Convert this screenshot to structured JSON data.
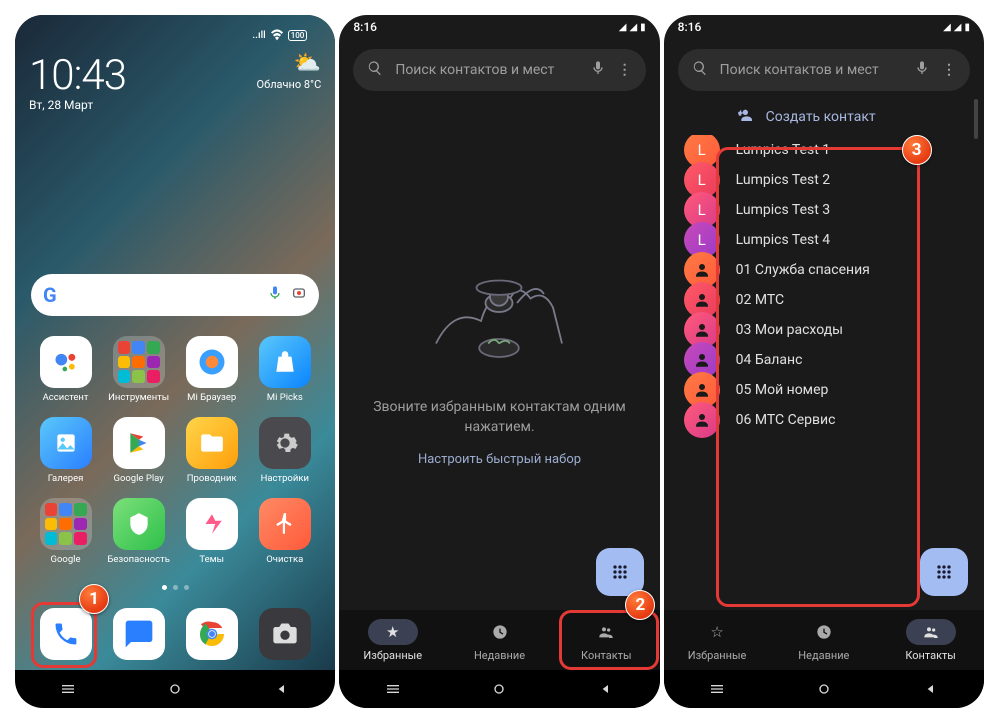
{
  "screen1": {
    "time": "10:43",
    "date": "Вт, 28 Март",
    "weather_text": "Облачно 8°C",
    "signal": "..ıll",
    "wifi": "📶",
    "battery": "100",
    "apps_row1": [
      {
        "label": "Ассистент",
        "bg": "#fff"
      },
      {
        "label": "Инструменты",
        "folder": true
      },
      {
        "label": "Mi Браузер",
        "bg": "#fff"
      },
      {
        "label": "Mi Picks",
        "bg": "linear-gradient(135deg,#5ac8fa,#0a84ff)"
      }
    ],
    "apps_row2": [
      {
        "label": "Галерея",
        "bg": "linear-gradient(135deg,#5ac8fa,#2a7fff)"
      },
      {
        "label": "Google Play",
        "bg": "#fff"
      },
      {
        "label": "Проводник",
        "bg": "linear-gradient(135deg,#ffd54a,#ff9f0a)"
      },
      {
        "label": "Настройки",
        "bg": "#4a4a4e"
      }
    ],
    "apps_row3": [
      {
        "label": "Google",
        "folder": true
      },
      {
        "label": "Безопасность",
        "bg": "linear-gradient(135deg,#7ce07a,#2ec04a)"
      },
      {
        "label": "Темы",
        "bg": "#fff"
      },
      {
        "label": "Очистка",
        "bg": "linear-gradient(135deg,#ff8a65,#ff5a3a)"
      }
    ],
    "dock": [
      {
        "name": "phone",
        "bg": "#fff",
        "color": "#2a7fff"
      },
      {
        "name": "messages",
        "bg": "#fff",
        "color": "#2a7fff"
      },
      {
        "name": "chrome",
        "bg": "#fff"
      },
      {
        "name": "camera",
        "bg": "#3a3a3e"
      }
    ]
  },
  "screen2": {
    "status_time": "8:16",
    "battery_icon": "▮",
    "search_placeholder": "Поиск контактов и мест",
    "empty_title": "Звоните избранным контактам одним нажатием.",
    "empty_link": "Настроить быстрый набор",
    "tabs": {
      "favorites": "Избранные",
      "recent": "Недавние",
      "contacts": "Контакты"
    }
  },
  "screen3": {
    "status_time": "8:16",
    "search_placeholder": "Поиск контактов и мест",
    "create_label": "Создать контакт",
    "sections": [
      {
        "letter": "L",
        "items": [
          {
            "name": "Lumpics Test 1",
            "initial": "L",
            "bg": "linear-gradient(135deg,#ff7a45,#ff5a3a)"
          },
          {
            "name": "Lumpics Test 2",
            "initial": "L",
            "bg": "linear-gradient(135deg,#ff5a6a,#e83a5a)"
          },
          {
            "name": "Lumpics Test 3",
            "initial": "L",
            "bg": "linear-gradient(135deg,#ff5a7a,#d83a8a)"
          },
          {
            "name": "Lumpics Test 4",
            "initial": "L",
            "bg": "linear-gradient(135deg,#c84aba,#9a3ac8)"
          }
        ]
      },
      {
        "letter": "#",
        "items": [
          {
            "name": "01 Служба спасения",
            "bg": "linear-gradient(135deg,#ff7a45,#ff5a3a)"
          },
          {
            "name": "02 МТС",
            "bg": "linear-gradient(135deg,#ff5a6a,#e83a5a)"
          },
          {
            "name": "03 Мои расходы",
            "bg": "linear-gradient(135deg,#ff5a7a,#d83a8a)"
          },
          {
            "name": "04 Баланс",
            "bg": "linear-gradient(135deg,#c84aba,#9a3ac8)"
          },
          {
            "name": "05 Мой номер",
            "bg": "linear-gradient(135deg,#ff7a45,#ff5a3a)"
          },
          {
            "name": "06 МТС Сервис",
            "bg": "linear-gradient(135deg,#ff5a7a,#d83a8a)"
          }
        ]
      }
    ],
    "tabs": {
      "favorites": "Избранные",
      "recent": "Недавние",
      "contacts": "Контакты"
    }
  }
}
